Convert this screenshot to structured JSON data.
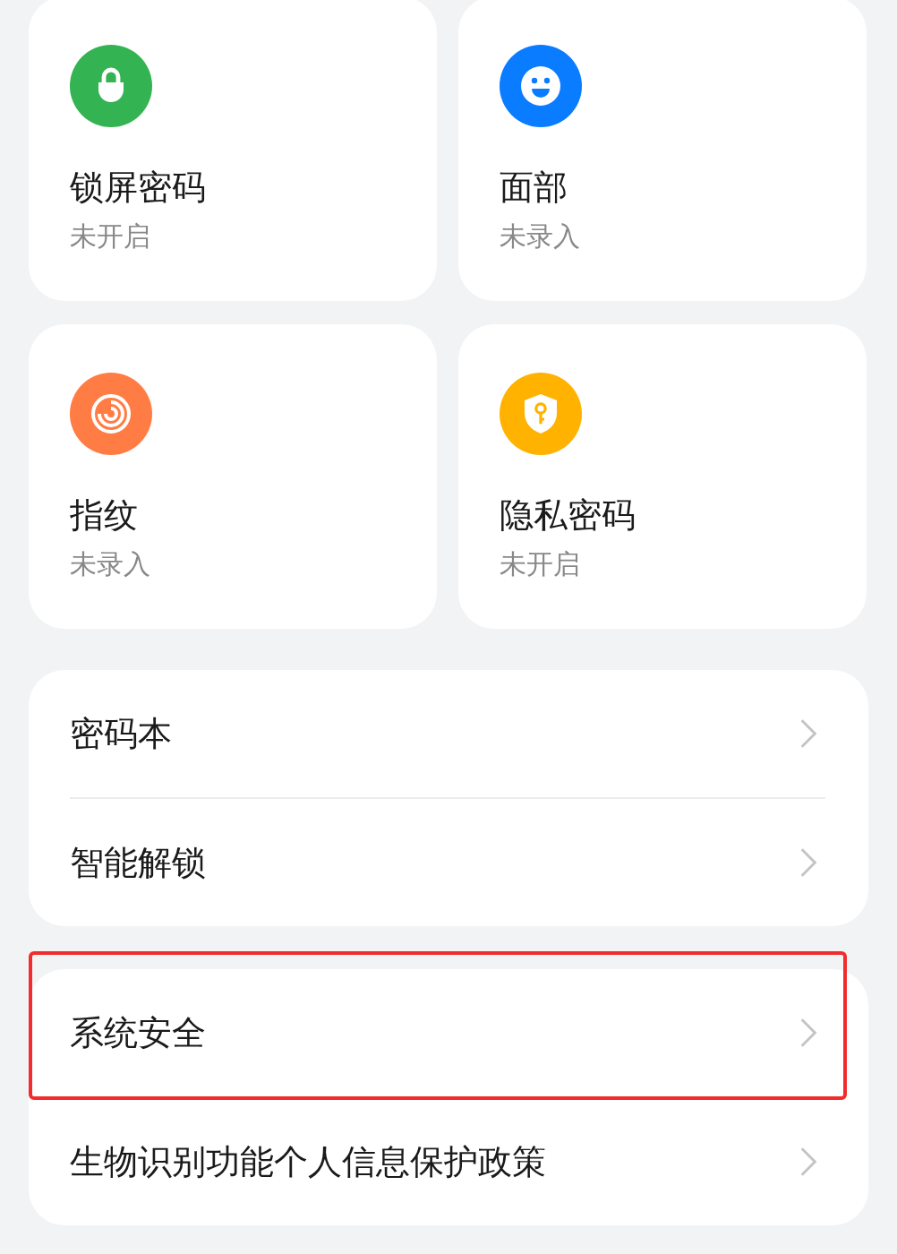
{
  "tiles": [
    {
      "kind": "lock",
      "title": "锁屏密码",
      "status": "未开启",
      "color": "#34b352"
    },
    {
      "kind": "face",
      "title": "面部",
      "status": "未录入",
      "color": "#0a7cff"
    },
    {
      "kind": "fingerprint",
      "title": "指纹",
      "status": "未录入",
      "color": "#ff7d45"
    },
    {
      "kind": "shield",
      "title": "隐私密码",
      "status": "未开启",
      "color": "#ffb200"
    }
  ],
  "groups": [
    {
      "items": [
        {
          "label": "密码本",
          "highlighted": false
        },
        {
          "label": "智能解锁",
          "highlighted": false
        }
      ]
    },
    {
      "items": [
        {
          "label": "系统安全",
          "highlighted": true
        },
        {
          "label": "生物识别功能个人信息保护政策",
          "highlighted": false
        }
      ]
    }
  ]
}
